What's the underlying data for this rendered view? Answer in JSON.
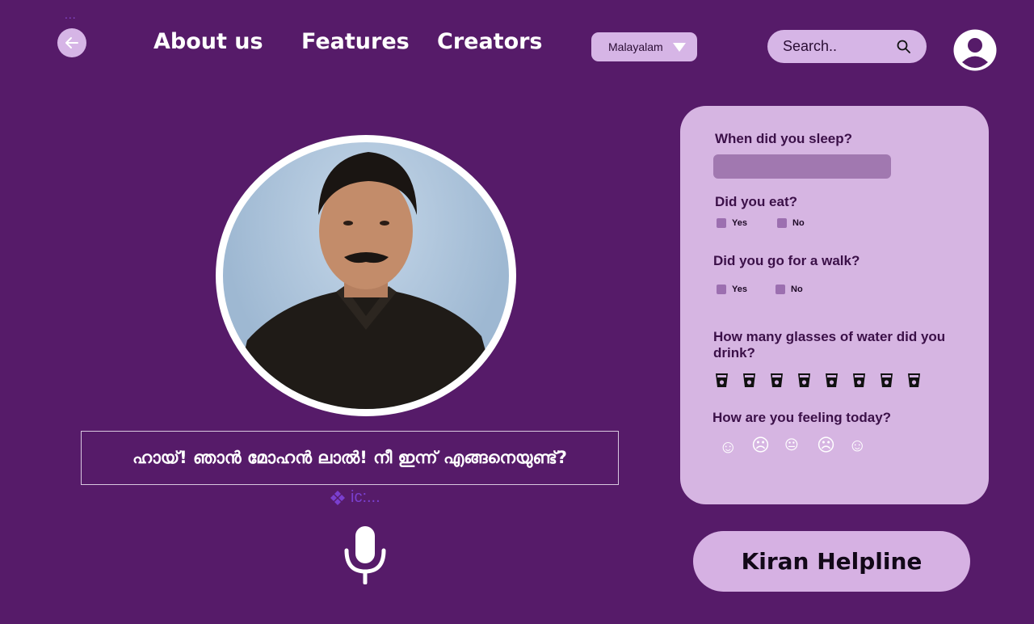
{
  "nav": {
    "links": [
      "About us",
      "Features",
      "Creators"
    ],
    "language": "Malayalam",
    "search_placeholder": "Search.."
  },
  "overlay": {
    "dots": "...",
    "ic_label": "ic:..."
  },
  "greeting": "ഹായ്! ഞാൻ മോഹൻ ലാൽ! നീ ഇന്ന് എങ്ങനെയുണ്ട്?",
  "form": {
    "q_sleep": "When did you sleep?",
    "q_eat": "Did you eat?",
    "q_walk": "Did you go for a walk?",
    "q_water": "How many glasses of water did you drink?",
    "q_feeling": "How are you feeling today?",
    "yes": "Yes",
    "no": "No",
    "glasses": 8,
    "moods": [
      "☺",
      "☹",
      "😐",
      "☹",
      "☺"
    ]
  },
  "helpline": "Kiran Helpline",
  "colors": {
    "background": "#561b69",
    "accent_light": "#d6b5e6",
    "panel": "#d6b5e2"
  },
  "icons": [
    "back-arrow-icon",
    "dropdown-triangle-icon",
    "search-icon",
    "user-avatar-icon",
    "water-glass-icon",
    "mood-face-icon",
    "microphone-icon",
    "component-icon"
  ]
}
